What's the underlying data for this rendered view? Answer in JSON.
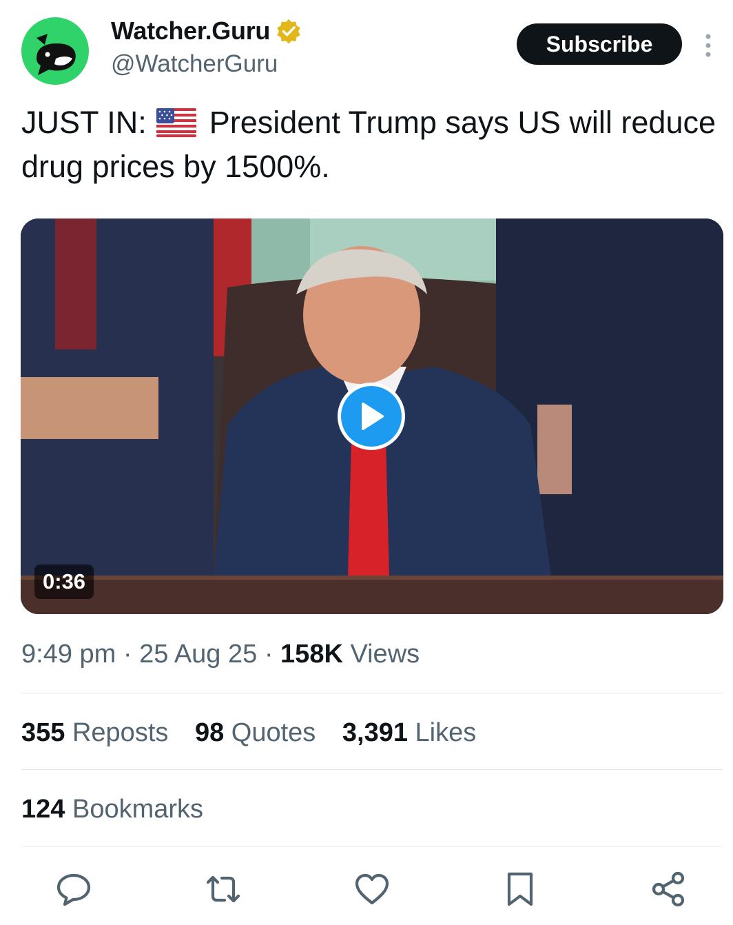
{
  "author": {
    "name": "Watcher.Guru",
    "handle": "@WatcherGuru",
    "verified": true,
    "avatar_icon": "whale-logo-icon",
    "avatar_color": "#2fd36a"
  },
  "header": {
    "subscribe_label": "Subscribe",
    "more_icon": "more-vertical-icon"
  },
  "tweet": {
    "prefix": "JUST IN:",
    "flag_icon": "us-flag-icon",
    "text": "President Trump says US will reduce drug prices by 1500%."
  },
  "media": {
    "type": "video",
    "duration": "0:36",
    "play_icon": "play-icon",
    "play_color": "#1d9bf0"
  },
  "meta": {
    "time": "9:49 pm",
    "separator": "·",
    "date": "25 Aug 25",
    "views_count": "158K",
    "views_label": "Views"
  },
  "stats": {
    "reposts_count": "355",
    "reposts_label": "Reposts",
    "quotes_count": "98",
    "quotes_label": "Quotes",
    "likes_count": "3,391",
    "likes_label": "Likes",
    "bookmarks_count": "124",
    "bookmarks_label": "Bookmarks"
  },
  "actions": [
    "reply-icon",
    "repost-icon",
    "like-icon",
    "bookmark-icon",
    "share-icon"
  ],
  "colors": {
    "text": "#0f1419",
    "secondary": "#536471",
    "verified_badge": "#e2b719"
  }
}
